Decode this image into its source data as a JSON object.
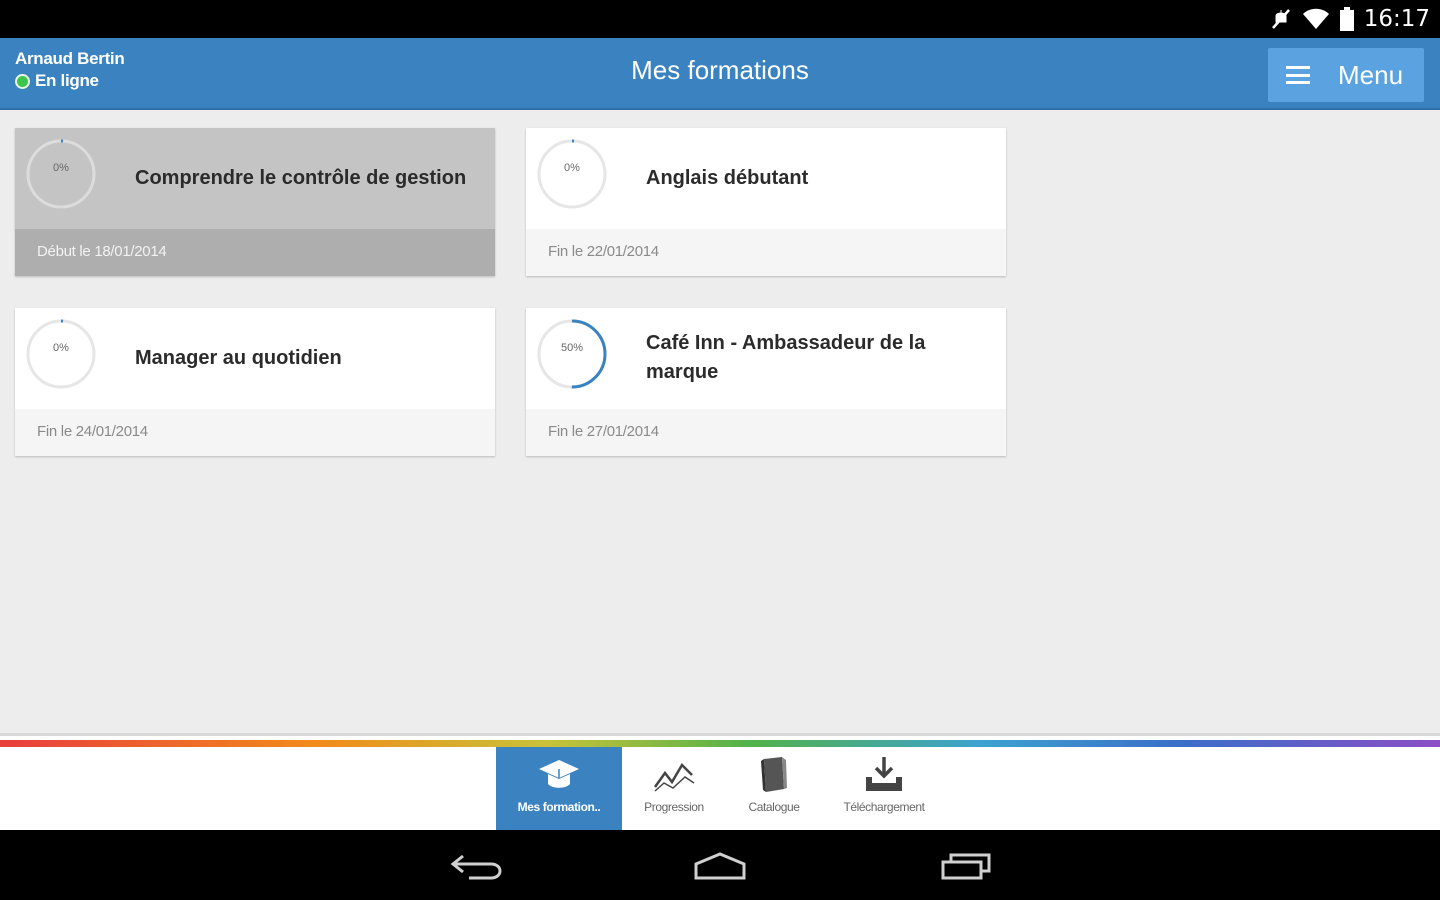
{
  "status_bar": {
    "time": "16:17",
    "icons": [
      "mute-icon",
      "wifi-icon",
      "battery-icon"
    ]
  },
  "header": {
    "user_name": "Arnaud Bertin",
    "user_status": "En ligne",
    "title": "Mes formations",
    "menu_label": "Menu"
  },
  "courses": [
    {
      "title": "Comprendre le contrôle de gestion",
      "date": "Début le 18/01/2014",
      "progress_label": "0%",
      "progress": 0,
      "selected": true
    },
    {
      "title": "Anglais débutant",
      "date": "Fin le 22/01/2014",
      "progress_label": "0%",
      "progress": 0,
      "selected": false
    },
    {
      "title": "Manager au quotidien",
      "date": "Fin le 24/01/2014",
      "progress_label": "0%",
      "progress": 0,
      "selected": false
    },
    {
      "title": "Café Inn - Ambassadeur de la marque",
      "date": "Fin le 27/01/2014",
      "progress_label": "50%",
      "progress": 0.5,
      "selected": false
    }
  ],
  "bottom_nav": [
    {
      "label": "Mes formation..",
      "icon": "graduation-cap-icon",
      "active": true
    },
    {
      "label": "Progression",
      "icon": "line-chart-icon",
      "active": false
    },
    {
      "label": "Catalogue",
      "icon": "book-icon",
      "active": false
    },
    {
      "label": "Téléchargement",
      "icon": "download-tray-icon",
      "active": false
    }
  ],
  "colors": {
    "primary": "#3a83c0",
    "menu_button": "#5aa3e0",
    "online": "#3ec64c",
    "progress_ring": "#3a83c0"
  }
}
